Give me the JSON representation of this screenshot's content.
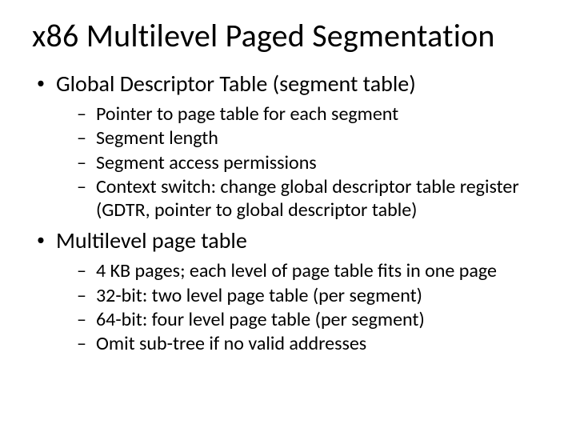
{
  "title": "x86 Multilevel Paged Segmentation",
  "items": [
    {
      "label": "Global Descriptor Table (segment table)",
      "sub": [
        "Pointer to page table for each segment",
        "Segment length",
        "Segment access permissions",
        "Context switch: change global descriptor table register (GDTR, pointer to global descriptor table)"
      ]
    },
    {
      "label": "Multilevel page table",
      "sub": [
        "4 KB pages; each level of page table fits in one page",
        "32-bit: two level page table (per segment)",
        "64-bit: four level page table (per segment)",
        "Omit sub-tree if no valid addresses"
      ]
    }
  ]
}
